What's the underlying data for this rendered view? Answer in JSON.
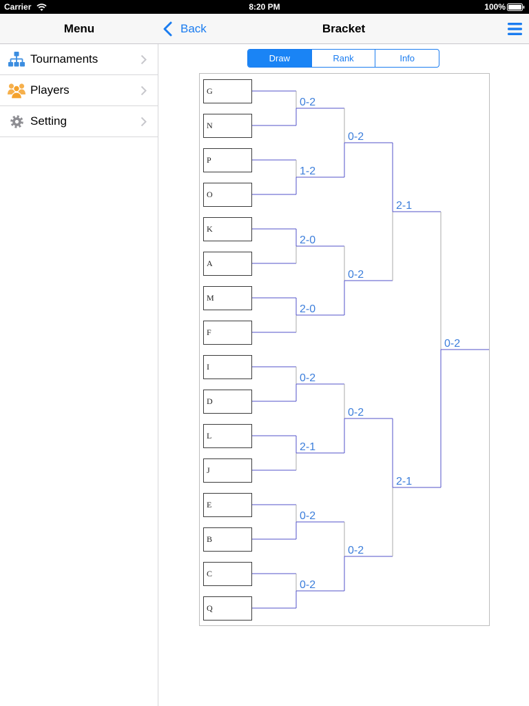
{
  "status_bar": {
    "carrier": "Carrier",
    "time": "8:20 PM",
    "battery": "100%",
    "wifi_icon": "wifi-icon",
    "battery_icon": "battery-icon"
  },
  "master": {
    "title": "Menu",
    "items": [
      {
        "label": "Tournaments",
        "icon": "tournament-hierarchy-icon",
        "icon_color": "#3b8de0"
      },
      {
        "label": "Players",
        "icon": "players-group-icon",
        "icon_color": "#f4a22d"
      },
      {
        "label": "Setting",
        "icon": "gear-icon",
        "icon_color": "#8e8e93"
      }
    ],
    "disclosure_icon": "chevron-right-icon"
  },
  "detail": {
    "back_label": "Back",
    "back_icon": "back-chevron-icon",
    "title": "Bracket",
    "menu_icon": "hamburger-menu-icon",
    "segments": [
      {
        "label": "Draw",
        "selected": true
      },
      {
        "label": "Rank",
        "selected": false
      },
      {
        "label": "Info",
        "selected": false
      }
    ]
  },
  "colors": {
    "accent": "#1a7cf0",
    "bracket_line": "#5052c8",
    "loser_line": "#a8a8a8",
    "score_text": "#3c7edb",
    "player_box_border": "#3a3a3a"
  },
  "bracket": {
    "players": [
      "G",
      "N",
      "P",
      "O",
      "K",
      "A",
      "M",
      "F",
      "I",
      "D",
      "L",
      "J",
      "E",
      "B",
      "C",
      "Q"
    ],
    "rounds": [
      [
        "0-2",
        "1-2",
        "2-0",
        "2-0",
        "0-2",
        "2-1",
        "0-2",
        "0-2"
      ],
      [
        "0-2",
        "0-2",
        "0-2",
        "0-2"
      ],
      [
        "2-1",
        "2-1"
      ],
      [
        "0-2"
      ]
    ]
  }
}
